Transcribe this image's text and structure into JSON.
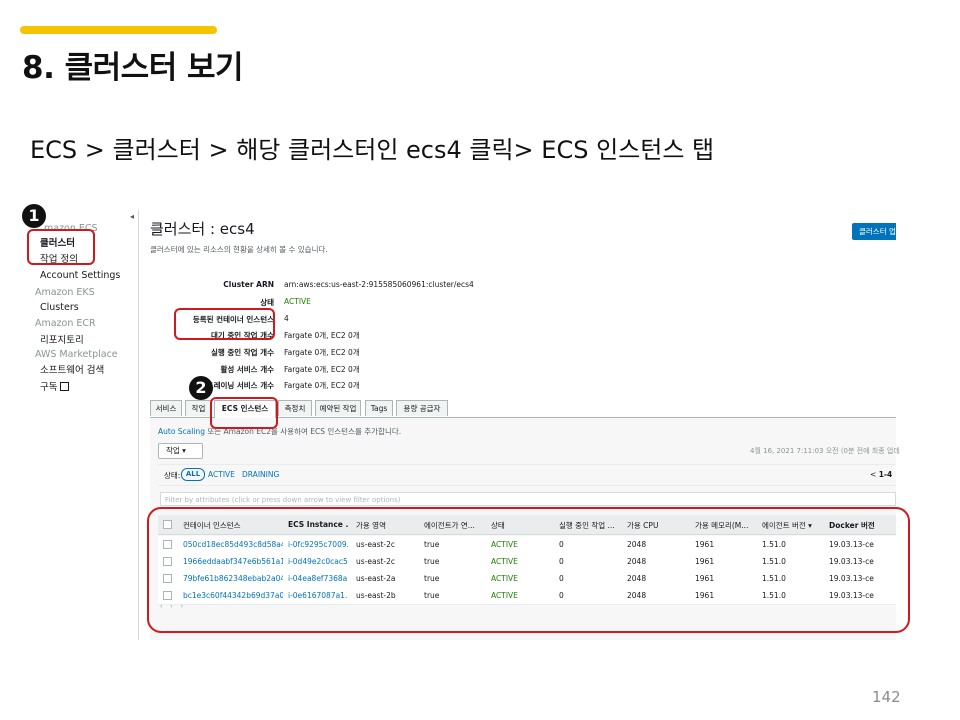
{
  "slide": {
    "title": "8. 클러스터 보기",
    "breadcrumb": "ECS > 클러스터 > 해당 클러스터인 ecs4 클릭> ECS 인스턴스 탭",
    "page_number": "142",
    "markers": [
      "1",
      "2"
    ]
  },
  "nav": {
    "ecs_header": "mazon ECS",
    "clusters": "클러스터",
    "task_def": "작업 정의",
    "account_settings": "Account Settings",
    "eks_header": "Amazon EKS",
    "eks_clusters": "Clusters",
    "ecr_header": "Amazon ECR",
    "repositories": "리포지토리",
    "marketplace_header": "AWS Marketplace",
    "software_search": "소프트웨어 검색",
    "subscriptions": "구독"
  },
  "cluster": {
    "title": "클러스터 : ecs4",
    "subtitle": "클러스터에 있는 리소스의 현황을 상세히 볼 수 있습니다.",
    "update_button": "클러스터 업",
    "details": [
      {
        "key": "Cluster ARN",
        "value": "arn:aws:ecs:us-east-2:915585060961:cluster/ecs4"
      },
      {
        "key": "상태",
        "value": "ACTIVE"
      },
      {
        "key": "등록된 컨테이너 인스턴스",
        "value": "4"
      },
      {
        "key": "대기 중인 작업 개수",
        "value": "Fargate 0개, EC2 0개"
      },
      {
        "key": "실행 중인 작업 개수",
        "value": "Fargate 0개, EC2 0개"
      },
      {
        "key": "활성 서비스 개수",
        "value": "Fargate 0개, EC2 0개"
      },
      {
        "key": "드레이닝 서비스 개수",
        "value": "Fargate 0개, EC2 0개"
      }
    ]
  },
  "tabs": [
    "서비스",
    "작업",
    "ECS 인스턴스",
    "측정치",
    "예약된 작업",
    "Tags",
    "용량 공급자"
  ],
  "instances_panel": {
    "autoscaling_link": "Auto Scaling",
    "autoscaling_text": " 또는 Amazon EC2를 사용하여 ECS 인스턴스를 추가합니다.",
    "actions_button": "작업 ▾",
    "timestamp": "4월 16, 2021 7:11:03 오전 (0분 전에 최종 업데",
    "status_label": "상태:",
    "status_all": "ALL",
    "status_active": "ACTIVE",
    "status_draining": "DRAINING",
    "pager_prefix": "<",
    "pager_range": "1-4",
    "filter_placeholder": "Filter by attributes (click or press down arrow to view filter options)",
    "columns": [
      "컨테이너 인스턴스",
      "ECS Instance ...",
      "가용 영역",
      "에이전트가 연...",
      "상태",
      "실행 중인 작업 ...",
      "가용 CPU",
      "가용 메모리(M...",
      "에이전트 버전 ▾",
      "Docker 버전"
    ],
    "rows": [
      [
        "050cd18ec85d493c8d58a4...",
        "i-0fc9295c7009...",
        "us-east-2c",
        "true",
        "ACTIVE",
        "0",
        "2048",
        "1961",
        "1.51.0",
        "19.03.13-ce"
      ],
      [
        "1966eddaabf347e6b561a1...",
        "i-0d49e2c0cac5...",
        "us-east-2c",
        "true",
        "ACTIVE",
        "0",
        "2048",
        "1961",
        "1.51.0",
        "19.03.13-ce"
      ],
      [
        "79bfe61b862348ebab2a04...",
        "i-04ea8ef7368a...",
        "us-east-2a",
        "true",
        "ACTIVE",
        "0",
        "2048",
        "1961",
        "1.51.0",
        "19.03.13-ce"
      ],
      [
        "bc1e3c60f44342b69d37a0...",
        "i-0e6167087a1...",
        "us-east-2b",
        "true",
        "ACTIVE",
        "0",
        "2048",
        "1961",
        "1.51.0",
        "19.03.13-ce"
      ]
    ],
    "scroll_arrows": "‹ › ›"
  },
  "colors": {
    "accent_bar": "#f5c400",
    "highlight": "#d0191f",
    "aws_link": "#0073bb",
    "aws_active": "#1d8102"
  },
  "icons": [
    "external-link-icon",
    "collapse-arrow-icon",
    "checkbox-icon"
  ]
}
